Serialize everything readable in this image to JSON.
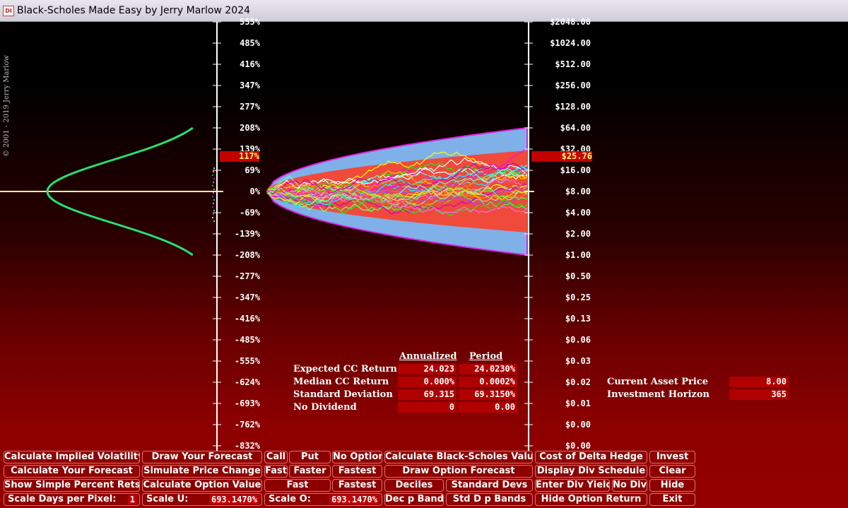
{
  "window": {
    "title": "Black-Scholes Made Easy by Jerry Marlow  2024",
    "icon": "app-icon",
    "icon_text": "DI"
  },
  "copyright": "© 2001 - 2019  Jerry Marlow",
  "left_axis": {
    "ticks": [
      "555%",
      "485%",
      "416%",
      "347%",
      "277%",
      "208%",
      "139%",
      "69%",
      "0%",
      "-69%",
      "-139%",
      "-208%",
      "-277%",
      "-347%",
      "-416%",
      "-485%",
      "-555%",
      "-624%",
      "-693%",
      "-762%",
      "-832%"
    ],
    "highlight": "117%"
  },
  "right_axis": {
    "ticks": [
      "$2048.00",
      "$1024.00",
      "$512.00",
      "$256.00",
      "$128.00",
      "$64.00",
      "$32.00",
      "$16.00",
      "$8.00",
      "$4.00",
      "$2.00",
      "$1.00",
      "$0.50",
      "$0.25",
      "$0.13",
      "$0.06",
      "$0.03",
      "$0.02",
      "$0.01",
      "$0.00",
      "$0.00"
    ],
    "highlight": "$25.76"
  },
  "colors": {
    "outer_band": "#7fb0e8",
    "inner_band": "#f04a3a",
    "envelope": "#e020e0",
    "bell_curve": "#28e070",
    "zero_line": "#ffff99"
  },
  "stats": {
    "header_annualized": "Annualized",
    "header_period": "Period",
    "rows": [
      {
        "label": "Expected CC Return",
        "annualized": "24.023",
        "period": "24.0230%"
      },
      {
        "label": "Median CC Return",
        "annualized": "0.000%",
        "period": "0.0002%"
      },
      {
        "label": "Standard Deviation",
        "annualized": "69.315",
        "period": "69.3150%"
      },
      {
        "label": "No Dividend",
        "annualized": "0",
        "period": "0.00"
      }
    ]
  },
  "inputs": {
    "current_asset_price_label": "Current Asset Price",
    "current_asset_price": "8.00",
    "investment_horizon_label": "Investment Horizon",
    "investment_horizon": "365"
  },
  "buttons": {
    "calc_implied_vol": "Calculate Implied Volatility",
    "draw_forecast": "Draw Your Forecast",
    "call": "Call",
    "put": "Put",
    "no_option": "No Option",
    "calc_bs_value": "Calculate Black-Scholes Value",
    "cost_delta_hedge": "Cost of Delta Hedge",
    "invest": "Invest",
    "calc_your_forecast": "Calculate Your Forecast",
    "simulate_price": "Simulate Price Change",
    "fast1": "Fast",
    "faster": "Faster",
    "fastest1": "Fastest",
    "draw_option_forecast": "Draw Option Forecast",
    "display_div_schedule": "Display Div Schedule",
    "clear": "Clear",
    "show_simple_pct": "Show Simple Percent Rets",
    "calc_option_value": "Calculate Option  Value",
    "fast2": "Fast",
    "fastest2": "Fastest",
    "deciles": "Deciles",
    "standard_devs": "Standard Devs",
    "enter_div_yield": "Enter Div Yield",
    "no_div": "No Div",
    "hide": "Hide",
    "scale_days_label": "Scale Days per Pixel:",
    "scale_days_value": "1",
    "scale_u_label": "Scale U:",
    "scale_u_value": "693.1470%",
    "scale_o_label": "Scale O:",
    "scale_o_value": "693.1470%",
    "dec_p_bands": "Dec p Bands",
    "std_d_p_bands": "Std D p Bands",
    "hide_option_return": "Hide Option Return",
    "exit": "Exit"
  }
}
